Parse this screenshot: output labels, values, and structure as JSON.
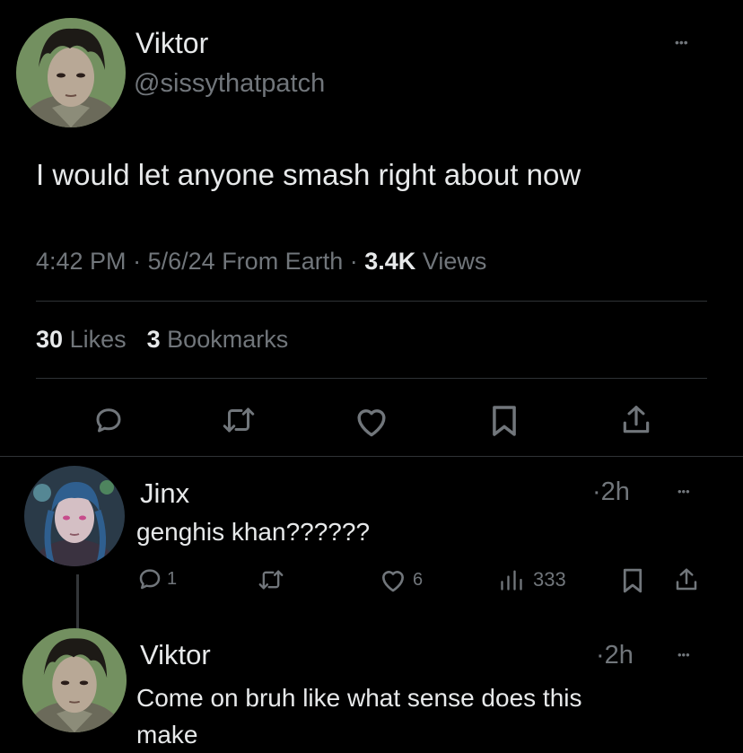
{
  "main_post": {
    "author_name": "Viktor",
    "handle": "@sissythatpatch",
    "text": "I would let anyone smash right about now",
    "time": "4:42 PM",
    "date": "5/6/24",
    "source": "From Earth",
    "views_count": "3.4K",
    "views_label": "Views",
    "likes_count": "30",
    "likes_label": "Likes",
    "bookmarks_count": "3",
    "bookmarks_label": "Bookmarks",
    "more": "•••"
  },
  "replies": [
    {
      "author_name": "Jinx",
      "time": "2h",
      "text": "genghis khan??????",
      "reply_count": "1",
      "like_count": "6",
      "view_count": "333",
      "more": "•••"
    },
    {
      "author_name": "Viktor",
      "time": "2h",
      "text_line1": "Come on bruh like what sense does this",
      "text_line2": "make",
      "more": "•••"
    }
  ],
  "separators": {
    "dot": "·"
  },
  "colors": {
    "background": "#000000",
    "text": "#e7e9ea",
    "muted": "#71767b",
    "divider": "#2f3336"
  }
}
